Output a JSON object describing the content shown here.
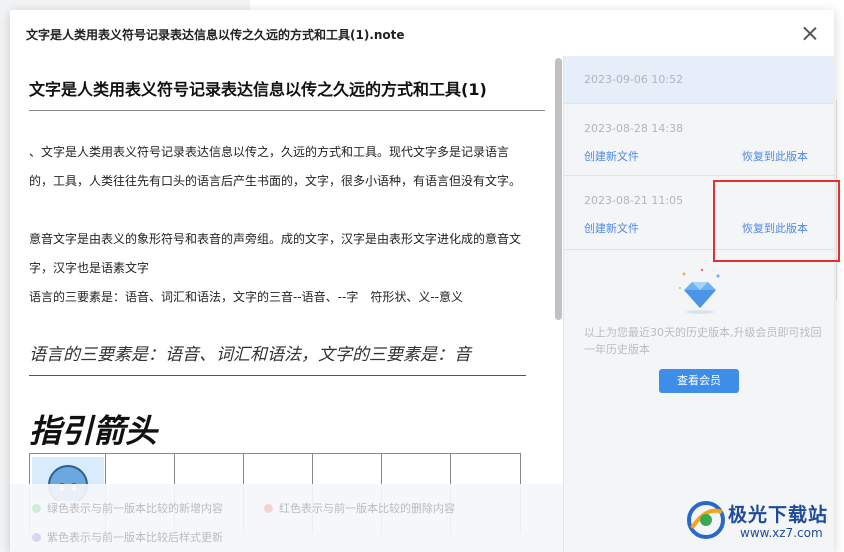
{
  "dialog": {
    "title": "文字是人类用表义符号记录表达信息以传之久远的方式和工具(1).note"
  },
  "document": {
    "title": "文字是人类用表义符号记录表达信息以传之久远的方式和工具(1)",
    "paragraphs": [
      "、文字是人类用表义符号记录表达信息以传之，久远的方式和工具。现代文字多是记录语言的，工具，人类往往先有口头的语言后产生书面的，文字，很多小语种，有语言但没有文字。",
      "意音文字是由表义的象形符号和表音的声旁组。成的文字，汉字是由表形文字进化成的意音文字，汉字也是语素文字",
      "语言的三要素是：语音、词汇和语法，文字的三音--语音、--字　符形状、义--意义"
    ],
    "italic_line": "语言的三要素是：语音、词汇和语法，文字的三要素是：音",
    "big_heading": "指引箭头"
  },
  "legend": {
    "added": "绿色表示与前一版本比较的新增内容",
    "deleted": "红色表示与前一版本比较的删除内容",
    "style": "紫色表示与前一版本比较后样式更新"
  },
  "versions": [
    {
      "time": "2023-09-06 10:52"
    },
    {
      "time": "2023-08-28 14:38",
      "create": "创建新文件",
      "restore": "恢复到此版本"
    },
    {
      "time": "2023-08-21 11:05",
      "create": "创建新文件",
      "restore": "恢复到此版本"
    }
  ],
  "upsell": {
    "text": "以上为您最近30天的历史版本,升级会员即可找回一年历史版本",
    "button": "查看会员"
  },
  "watermark": {
    "name": "极光下载站",
    "url": "www.xz7.com"
  },
  "colors": {
    "accent": "#3e8de8",
    "link": "#4d8ae8",
    "highlight": "#e03131",
    "legend_added": "#cdeed6",
    "legend_deleted": "#f8d2d2",
    "legend_style": "#d5d6f3"
  }
}
